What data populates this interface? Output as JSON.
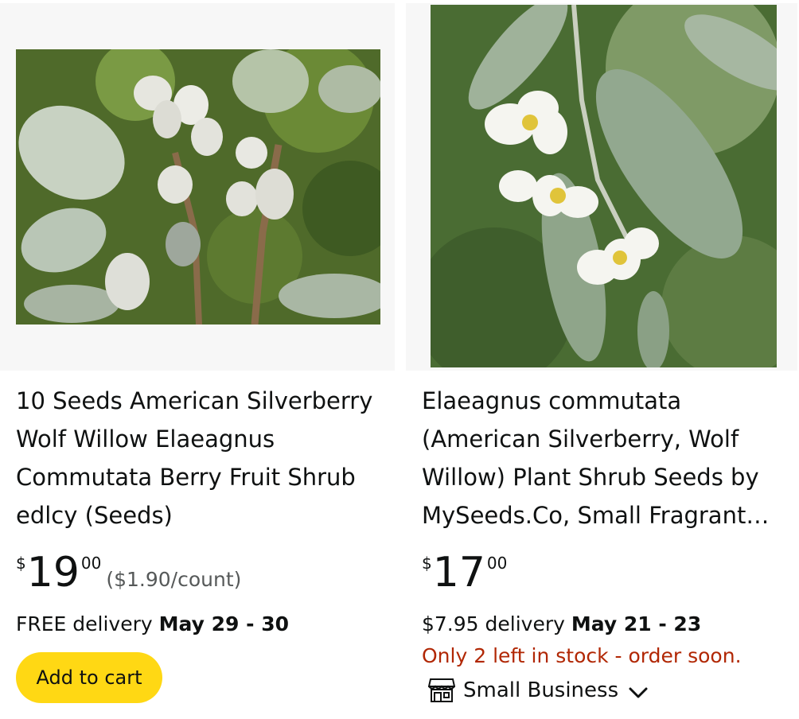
{
  "products": [
    {
      "title": "10 Seeds American Silverberry Wolf Willow Elaeagnus Commutata Berry Fruit Shrub edlcy (Seeds)",
      "price_symbol": "$",
      "price_whole": "19",
      "price_fraction": "00",
      "unit_price": "($1.90/count)",
      "delivery_prefix": "FREE delivery",
      "delivery_dates": "May 29 - 30",
      "add_to_cart_label": "Add to cart"
    },
    {
      "title": "Elaeagnus commutata (American Silverberry, Wolf Willow) Plant Shrub Seeds by MySeeds.Co, Small Fragrant…",
      "price_symbol": "$",
      "price_whole": "17",
      "price_fraction": "00",
      "delivery_prefix": "$7.95 delivery",
      "delivery_dates": "May 21 - 23",
      "stock_message": "Only 2 left in stock - order soon.",
      "badge_label": "Small Business",
      "badge_icon": "store-icon"
    }
  ],
  "colors": {
    "add_to_cart": "#ffd814",
    "stock_warning": "#b12704",
    "secondary_text": "#565959"
  }
}
